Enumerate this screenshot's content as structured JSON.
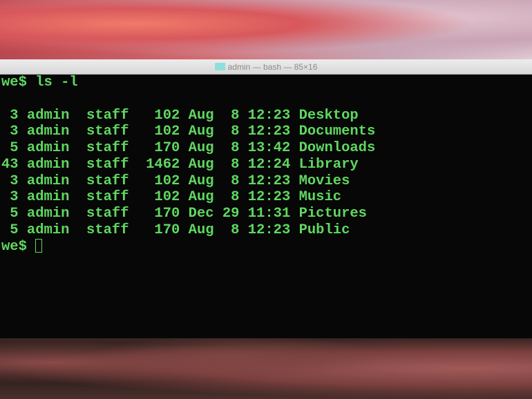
{
  "window": {
    "title": "admin — bash — 85×16"
  },
  "terminal": {
    "command_line": "we$ ls -l",
    "listing": [
      " 3 admin  staff   102 Aug  8 12:23 Desktop",
      " 3 admin  staff   102 Aug  8 12:23 Documents",
      " 5 admin  staff   170 Aug  8 13:42 Downloads",
      "43 admin  staff  1462 Aug  8 12:24 Library",
      " 3 admin  staff   102 Aug  8 12:23 Movies",
      " 3 admin  staff   102 Aug  8 12:23 Music",
      " 5 admin  staff   170 Dec 29 11:31 Pictures",
      " 5 admin  staff   170 Aug  8 12:23 Public"
    ],
    "prompt": "we$ "
  }
}
